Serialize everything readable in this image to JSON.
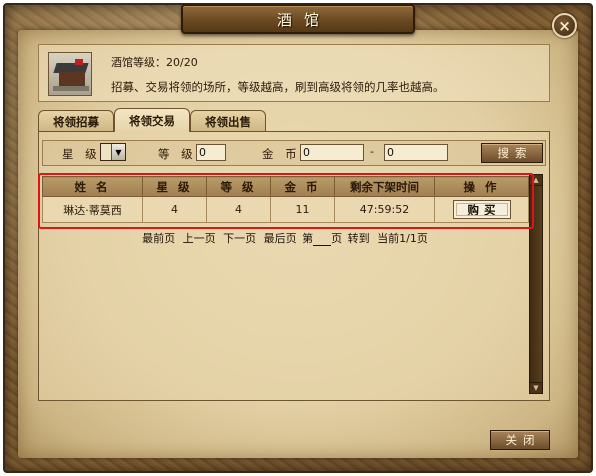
{
  "window": {
    "title": "酒馆",
    "close_icon": "×"
  },
  "info": {
    "level_text": "酒馆等级：20/20",
    "description": "招募、交易将领的场所，等级越高，刷到高级将领的几率也越高。"
  },
  "tabs": [
    {
      "label": "将领招募",
      "active": false
    },
    {
      "label": "将领交易",
      "active": true
    },
    {
      "label": "将领出售",
      "active": false
    }
  ],
  "filters": {
    "star_label": "星 级",
    "level_label": "等 级",
    "level_value": "0",
    "gold_label": "金 币",
    "gold_min": "0",
    "range_sep": "-",
    "gold_max": "0",
    "search_label": "搜索"
  },
  "table": {
    "columns": [
      "姓 名",
      "星 级",
      "等 级",
      "金 币",
      "剩余下架时间",
      "操 作"
    ],
    "rows": [
      {
        "name": "琳达·蒂莫西",
        "star": "4",
        "level": "4",
        "gold": "11",
        "time_left": "47:59:52",
        "action": "购买"
      }
    ]
  },
  "pager": {
    "first": "最前页",
    "prev": "上一页",
    "next": "下一页",
    "last": "最后页",
    "page_prefix": "第",
    "page_suffix": "页",
    "goto": "转到",
    "current": "当前1/1页"
  },
  "footer": {
    "close_label": "关闭"
  },
  "colors": {
    "highlight": "#e01414",
    "parchment": "#e2cfa3",
    "frame": "#7d5a30"
  }
}
